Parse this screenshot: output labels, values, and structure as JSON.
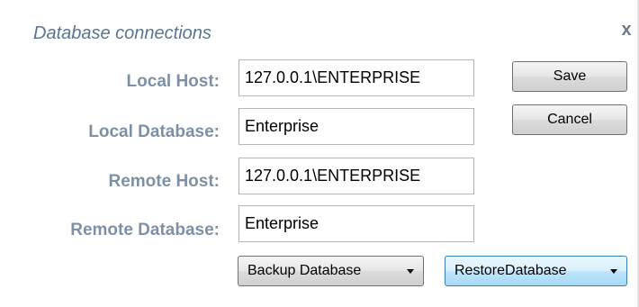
{
  "dialog": {
    "title": "Database connections",
    "close_label": "x"
  },
  "form": {
    "local_host": {
      "label": "Local Host:",
      "value": "127.0.0.1\\ENTERPRISE"
    },
    "local_database": {
      "label": "Local Database:",
      "value": "Enterprise"
    },
    "remote_host": {
      "label": "Remote Host:",
      "value": "127.0.0.1\\ENTERPRISE"
    },
    "remote_database": {
      "label": "Remote Database:",
      "value": "Enterprise"
    }
  },
  "buttons": {
    "save": "Save",
    "cancel": "Cancel",
    "backup": "Backup Database",
    "restore": "RestoreDatabase"
  },
  "icons": {
    "close": "close-icon",
    "dropdown": "chevron-down-icon"
  }
}
